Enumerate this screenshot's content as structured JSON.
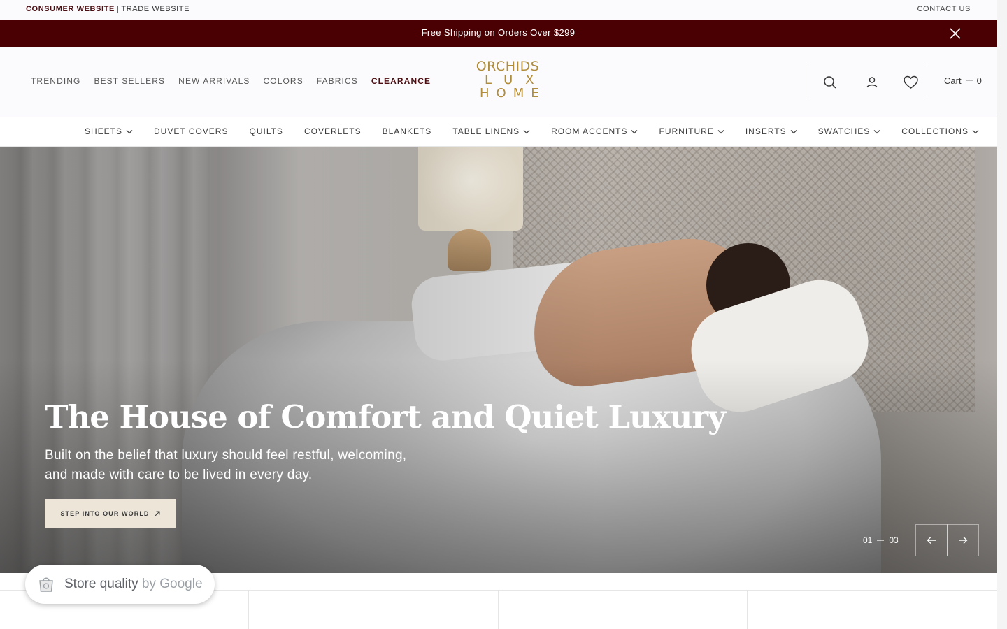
{
  "utility": {
    "consumer_label": "CONSUMER WEBSITE",
    "separator": "|",
    "trade_label": "TRADE WEBSITE",
    "contact_label": "CONTACT US"
  },
  "announcement": {
    "text": "Free Shipping on Orders Over $299",
    "close_icon": "close-icon",
    "background": "#4a0003"
  },
  "header": {
    "primary_nav": [
      "TRENDING",
      "BEST SELLERS",
      "NEW ARRIVALS",
      "COLORS",
      "FABRICS",
      "CLEARANCE"
    ],
    "logo": {
      "line1": "ORCHIDS",
      "line2": "LUX",
      "line3": "HOME",
      "color": "#b08d3c"
    },
    "icons": [
      "search-icon",
      "account-icon",
      "heart-icon"
    ],
    "cart_label": "Cart",
    "cart_count": "0"
  },
  "category_nav": {
    "items": [
      {
        "label": "SHEETS",
        "dropdown": true
      },
      {
        "label": "DUVET COVERS",
        "dropdown": false
      },
      {
        "label": "QUILTS",
        "dropdown": false
      },
      {
        "label": "COVERLETS",
        "dropdown": false
      },
      {
        "label": "BLANKETS",
        "dropdown": false
      },
      {
        "label": "TABLE LINENS",
        "dropdown": true
      },
      {
        "label": "ROOM ACCENTS",
        "dropdown": true
      },
      {
        "label": "FURNITURE",
        "dropdown": true
      },
      {
        "label": "INSERTS",
        "dropdown": true
      },
      {
        "label": "SWATCHES",
        "dropdown": true
      },
      {
        "label": "COLLECTIONS",
        "dropdown": true
      }
    ]
  },
  "hero": {
    "title": "The House of Comfort and Quiet Luxury",
    "subtitle": "Built on the belief that luxury should feel restful, welcoming, and made with care to be lived in every day.",
    "cta_label": "STEP INTO OUR WORLD",
    "cta_icon": "arrow-up-right-icon",
    "slide_current": "01",
    "slide_total": "03",
    "prev_icon": "arrow-left-icon",
    "next_icon": "arrow-right-icon"
  },
  "badge": {
    "label": "Store quality",
    "by": "by Google",
    "icon": "shopping-bag-icon"
  }
}
